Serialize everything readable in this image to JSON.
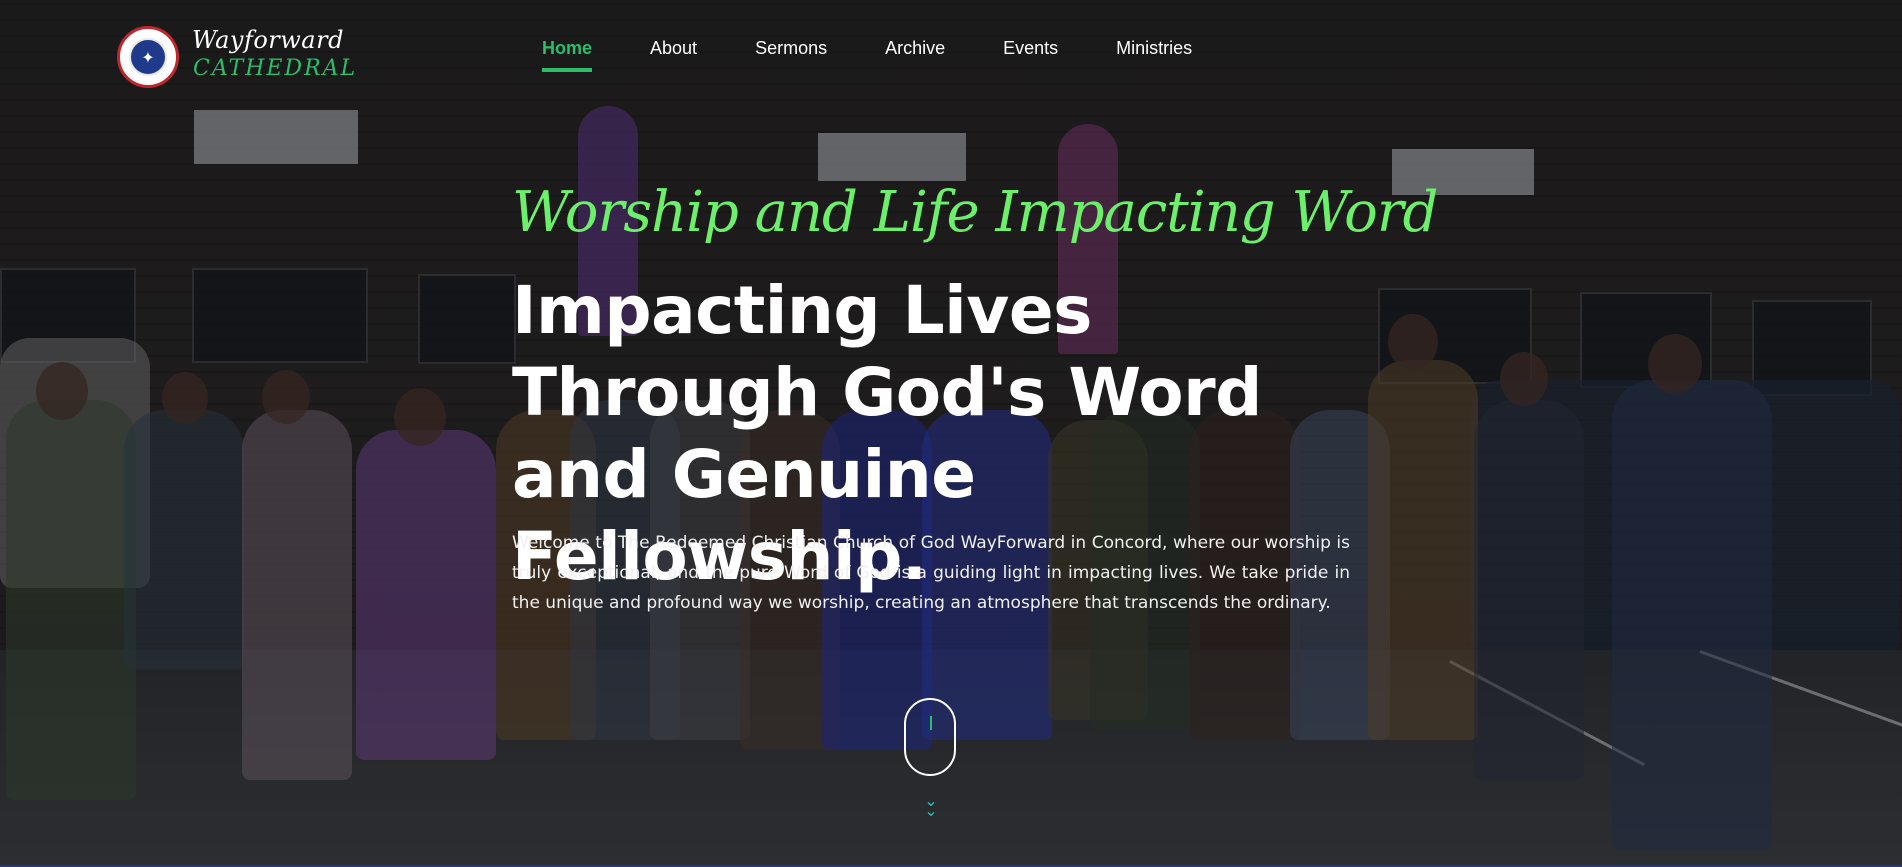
{
  "brand": {
    "name_top": "Wayforward",
    "name_bottom": "CATHEDRAL"
  },
  "nav": {
    "items": [
      {
        "label": "Home",
        "active": true
      },
      {
        "label": "About",
        "active": false
      },
      {
        "label": "Sermons",
        "active": false
      },
      {
        "label": "Archive",
        "active": false
      },
      {
        "label": "Events",
        "active": false
      },
      {
        "label": "Ministries",
        "active": false
      }
    ]
  },
  "hero": {
    "tagline": "Worship and Life Impacting Word",
    "headline": "Impacting Lives Through God's Word and Genuine Fellowship.",
    "lead": "Welcome to The Redeemed Christian Church of God WayForward in Concord, where our worship is truly exceptional, and the pure Word of God is a guiding light in impacting lives. We take pride in the unique and profound way we worship, creating an atmosphere that transcends the ordinary."
  },
  "colors": {
    "accent": "#2bbd6a",
    "tagline": "#6cf06b",
    "scroll_chevron": "#2ec0c0"
  },
  "icons": {
    "logo": "church-logo",
    "scroll": "mouse-scroll-icon",
    "chevron": "double-chevron-down-icon"
  }
}
